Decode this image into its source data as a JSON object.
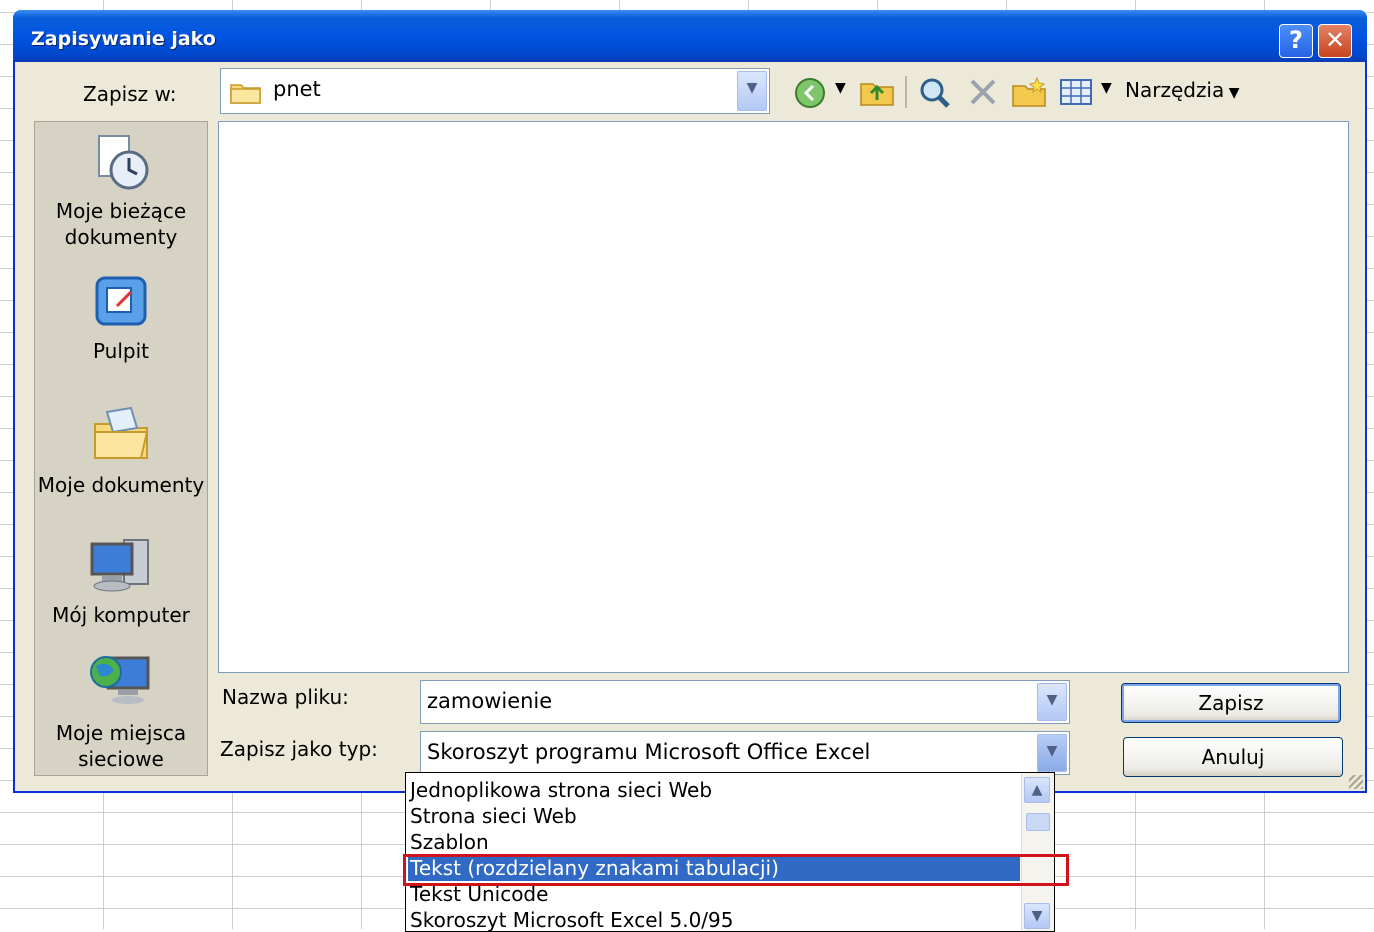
{
  "dialog": {
    "title": "Zapisywanie jako",
    "help_glyph": "?",
    "close_glyph": "✕"
  },
  "toolbar": {
    "save_in_label": "Zapisz w:",
    "location": "pnet",
    "tools_label": "Narzędzia",
    "icons": [
      "back-icon",
      "up-folder-icon",
      "search-web-icon",
      "delete-icon",
      "new-folder-icon",
      "views-icon"
    ]
  },
  "places": [
    {
      "label": "Moje bieżące dokumenty",
      "icon": "recent-documents-icon"
    },
    {
      "label": "Pulpit",
      "icon": "desktop-icon"
    },
    {
      "label": "Moje dokumenty",
      "icon": "my-documents-icon"
    },
    {
      "label": "Mój komputer",
      "icon": "my-computer-icon"
    },
    {
      "label": "Moje miejsca sieciowe",
      "icon": "network-places-icon"
    }
  ],
  "form": {
    "filename_label": "Nazwa pliku:",
    "filename_value": "zamowienie",
    "filetype_label": "Zapisz jako typ:",
    "filetype_value": "Skoroszyt programu Microsoft Office Excel"
  },
  "buttons": {
    "save": "Zapisz",
    "cancel": "Anuluj"
  },
  "filetype_options": [
    "Jednoplikowa strona sieci Web",
    "Strona sieci Web",
    "Szablon",
    "Tekst (rozdzielany znakami tabulacji)",
    "Tekst Unicode",
    "Skoroszyt Microsoft Excel 5.0/95"
  ],
  "selected_option_index": 3,
  "colors": {
    "titlebar": "#0054e3",
    "dialog_bg": "#ece9d8",
    "selection": "#316ac5",
    "highlight_border": "#d0131b"
  }
}
